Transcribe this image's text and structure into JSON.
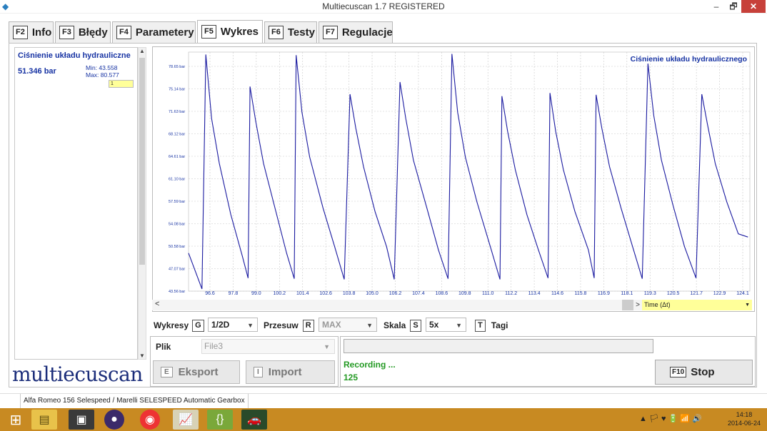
{
  "window": {
    "title": "Multiecuscan 1.7 REGISTERED",
    "min": "–",
    "max": "🗗",
    "close": "✕"
  },
  "tabs": [
    {
      "key": "F2",
      "label": "Info"
    },
    {
      "key": "F3",
      "label": "Błędy"
    },
    {
      "key": "F4",
      "label": "Parametery"
    },
    {
      "key": "F5",
      "label": "Wykres",
      "active": true
    },
    {
      "key": "F6",
      "label": "Testy"
    },
    {
      "key": "F7",
      "label": "Regulacje"
    }
  ],
  "param": {
    "title": "Ciśnienie układu hydrauliczne",
    "value": "51.346 bar",
    "min": "Min: 43.558",
    "max": "Max: 80.577",
    "dropdown": "1"
  },
  "chart_data": {
    "type": "line",
    "title": "Ciśnienie układu hydraulicznego",
    "xlabel": "Time (Δt)",
    "ylabel": "",
    "x_ticks": [
      "96.6",
      "97.8",
      "99.0",
      "100.2",
      "101.4",
      "102.6",
      "103.8",
      "105.0",
      "106.2",
      "107.4",
      "108.6",
      "109.8",
      "111.0",
      "112.2",
      "113.4",
      "114.6",
      "115.8",
      "116.9",
      "118.1",
      "119.3",
      "120.5",
      "121.7",
      "122.9",
      "124.1"
    ],
    "y_ticks": [
      "43.56 bar",
      "47.07 bar",
      "50.58 bar",
      "54.08 bar",
      "57.59 bar",
      "61.10 bar",
      "64.61 bar",
      "68.12 bar",
      "71.63 bar",
      "75.14 bar",
      "78.65 bar"
    ],
    "xlim": [
      95.8,
      125.0
    ],
    "ylim": [
      43.56,
      78.65
    ],
    "grid": true,
    "color": "#1a1aa0",
    "points": [
      [
        95.8,
        49.5
      ],
      [
        96.5,
        43.9
      ],
      [
        96.7,
        80.5
      ],
      [
        97.0,
        70.5
      ],
      [
        97.4,
        63.5
      ],
      [
        98.0,
        55.5
      ],
      [
        98.6,
        49.0
      ],
      [
        98.9,
        45.6
      ],
      [
        99.0,
        75.5
      ],
      [
        99.3,
        70.0
      ],
      [
        99.7,
        63.5
      ],
      [
        100.3,
        56.5
      ],
      [
        100.9,
        49.5
      ],
      [
        101.3,
        45.5
      ],
      [
        101.4,
        80.4
      ],
      [
        101.7,
        71.5
      ],
      [
        102.1,
        64.5
      ],
      [
        102.8,
        56.5
      ],
      [
        103.4,
        50.5
      ],
      [
        103.9,
        45.4
      ],
      [
        104.2,
        74.3
      ],
      [
        104.5,
        69.0
      ],
      [
        104.9,
        63.0
      ],
      [
        105.5,
        56.0
      ],
      [
        106.1,
        50.5
      ],
      [
        106.5,
        45.4
      ],
      [
        106.8,
        76.2
      ],
      [
        107.1,
        70.5
      ],
      [
        107.5,
        64.0
      ],
      [
        108.2,
        56.5
      ],
      [
        108.8,
        50.0
      ],
      [
        109.3,
        45.5
      ],
      [
        109.5,
        80.6
      ],
      [
        109.8,
        71.5
      ],
      [
        110.2,
        64.5
      ],
      [
        110.8,
        57.5
      ],
      [
        111.5,
        50.5
      ],
      [
        112.0,
        45.4
      ],
      [
        112.1,
        74.0
      ],
      [
        112.4,
        68.5
      ],
      [
        112.8,
        62.5
      ],
      [
        113.4,
        55.5
      ],
      [
        114.0,
        50.0
      ],
      [
        114.5,
        45.6
      ],
      [
        114.6,
        74.5
      ],
      [
        114.9,
        68.5
      ],
      [
        115.3,
        62.5
      ],
      [
        115.9,
        56.0
      ],
      [
        116.6,
        50.0
      ],
      [
        116.9,
        45.6
      ],
      [
        117.0,
        74.2
      ],
      [
        117.3,
        69.0
      ],
      [
        117.7,
        63.0
      ],
      [
        118.3,
        56.5
      ],
      [
        118.9,
        50.5
      ],
      [
        119.4,
        45.5
      ],
      [
        119.7,
        79.1
      ],
      [
        120.0,
        71.0
      ],
      [
        120.4,
        64.0
      ],
      [
        121.0,
        57.0
      ],
      [
        121.6,
        50.5
      ],
      [
        122.2,
        45.6
      ],
      [
        122.5,
        74.3
      ],
      [
        122.8,
        69.5
      ],
      [
        123.2,
        63.5
      ],
      [
        123.8,
        57.5
      ],
      [
        124.4,
        52.5
      ],
      [
        124.9,
        52.0
      ]
    ]
  },
  "time_axis": {
    "label": "Time (Δt)",
    "right_arrow": ">",
    "left_arrow": "<"
  },
  "controls": {
    "wykresy_label": "Wykresy",
    "wykresy_key": "G",
    "wykresy_value": "1/2D",
    "przesuw_label": "Przesuw",
    "przesuw_key": "R",
    "przesuw_value": "MAX",
    "skala_label": "Skala",
    "skala_key": "S",
    "skala_value": "5x",
    "tagi_key": "T",
    "tagi_label": "Tagi"
  },
  "file": {
    "label": "Plik",
    "value": "File3"
  },
  "buttons": {
    "eksport_key": "E",
    "eksport": "Eksport",
    "import_key": "I",
    "import": "Import",
    "stop_key": "F10",
    "stop": "Stop"
  },
  "recording": {
    "status": "Recording ...",
    "count": "125"
  },
  "logo": "multiecuscan",
  "status_text": "Alfa Romeo 156 Selespeed / Marelli SELESPEED Automatic Gearbox",
  "clock": {
    "time": "14:18",
    "date": "2014-06-24"
  },
  "tray_icons": "▲ 🏳 ♥ 🔋 📶 🔊",
  "colors": {
    "accent": "#1733a3",
    "line": "#1a1aa0",
    "recording": "#229922",
    "taskbar": "#c88a22"
  }
}
